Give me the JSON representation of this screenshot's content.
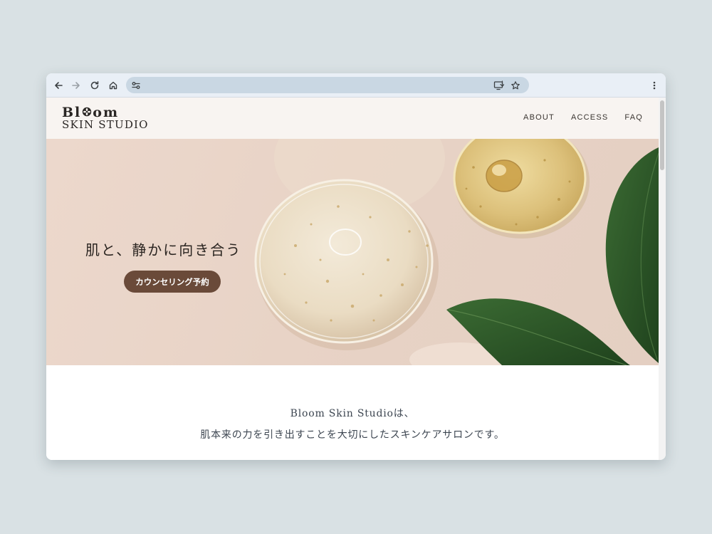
{
  "browser": {
    "address_value": "",
    "address_placeholder": "",
    "icons": {
      "back": "arrow-left-icon",
      "forward": "arrow-right-icon",
      "reload": "reload-icon",
      "home": "home-icon",
      "site_info": "tune-icon",
      "install": "install-app-icon",
      "bookmark": "star-icon",
      "menu": "kebab-menu-icon"
    }
  },
  "site": {
    "logo": {
      "line1_part1": "Bl",
      "line1_part2": "om",
      "line2": "SKIN STUDIO"
    },
    "nav": [
      {
        "label": "ABOUT"
      },
      {
        "label": "ACCESS"
      },
      {
        "label": "FAQ"
      }
    ],
    "hero": {
      "title": "肌と、静かに向き合う",
      "cta_label": "カウンセリング予約"
    },
    "intro": {
      "line1": "Bloom Skin Studioは、",
      "line2": "肌本来の力を引き出すことを大切にしたスキンケアサロンです。"
    }
  },
  "colors": {
    "page_bg": "#d9e1e4",
    "toolbar_bg": "#e9eff6",
    "omnibox_bg": "#c9d7e3",
    "header_bg": "#f8f4f0",
    "hero_bg": "#e8d3c6",
    "cta_bg": "#6a4a39",
    "leaf": "#2f5a2a",
    "oil": "#d9b766",
    "text_dark": "#2b2521",
    "text_intro": "#3c4550"
  }
}
